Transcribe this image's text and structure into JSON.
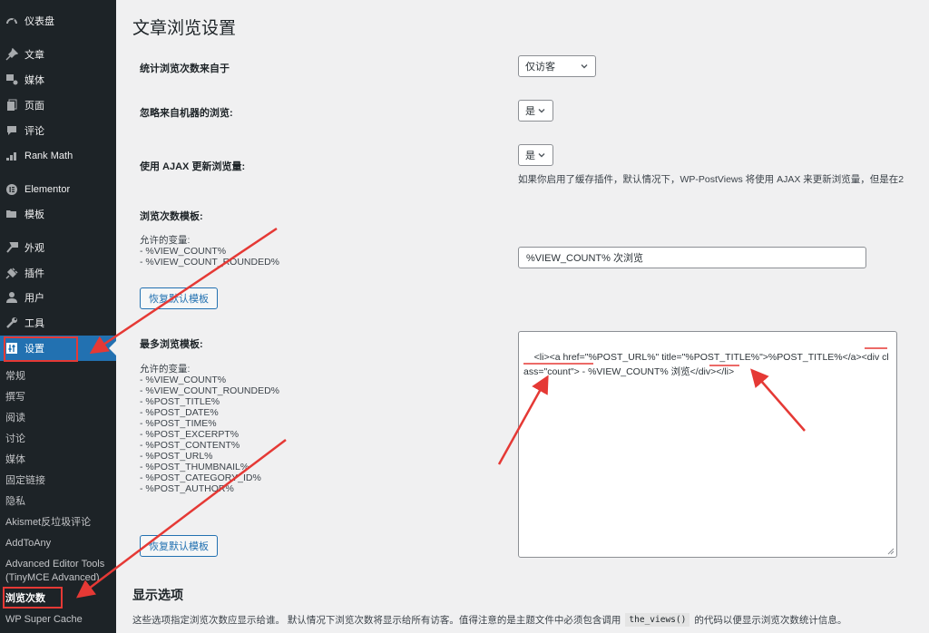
{
  "sidebar": {
    "items": [
      {
        "label": "仪表盘",
        "icon": "dashboard-icon"
      },
      {
        "label": "文章",
        "icon": "pin-icon"
      },
      {
        "label": "媒体",
        "icon": "media-icon"
      },
      {
        "label": "页面",
        "icon": "pages-icon"
      },
      {
        "label": "评论",
        "icon": "comment-icon"
      },
      {
        "label": "Rank Math",
        "icon": "rank-math-icon"
      },
      {
        "label": "Elementor",
        "icon": "elementor-icon"
      },
      {
        "label": "模板",
        "icon": "folder-icon"
      },
      {
        "label": "外观",
        "icon": "brush-icon"
      },
      {
        "label": "插件",
        "icon": "plug-icon"
      },
      {
        "label": "用户",
        "icon": "user-icon"
      },
      {
        "label": "工具",
        "icon": "wrench-icon"
      },
      {
        "label": "设置",
        "icon": "settings-icon",
        "active": true
      }
    ],
    "submenu": [
      "常规",
      "撰写",
      "阅读",
      "讨论",
      "媒体",
      "固定链接",
      "隐私",
      "Akismet反垃圾评论",
      "AddToAny",
      "Advanced Editor Tools",
      "(TinyMCE Advanced)",
      "浏览次数",
      "WP Super Cache"
    ],
    "current_submenu": "浏览次数"
  },
  "page": {
    "title": "文章浏览设置",
    "rows": {
      "count_from": {
        "label": "统计浏览次数来自于",
        "value": "仅访客"
      },
      "exclude_bots": {
        "label": "忽略来自机器的浏览:",
        "value": "是"
      },
      "use_ajax": {
        "label": "使用 AJAX 更新浏览量:",
        "value": "是",
        "help": "如果你启用了缓存插件，默认情况下，WP-PostViews 将使用 AJAX 来更新浏览量，但是在2"
      },
      "views_template": {
        "label": "浏览次数模板:",
        "vars_title": "允许的变量:",
        "vars": [
          "- %VIEW_COUNT%",
          "- %VIEW_COUNT_ROUNDED%"
        ],
        "value": "%VIEW_COUNT% 次浏览",
        "restore_button": "恢复默认模板"
      },
      "most_viewed_template": {
        "label": "最多浏览模板:",
        "vars_title": "允许的变量:",
        "vars": [
          "- %VIEW_COUNT%",
          "- %VIEW_COUNT_ROUNDED%",
          "- %POST_TITLE%",
          "- %POST_DATE%",
          "- %POST_TIME%",
          "- %POST_EXCERPT%",
          "- %POST_CONTENT%",
          "- %POST_URL%",
          "- %POST_THUMBNAIL%",
          "- %POST_CATEGORY_ID%",
          "- %POST_AUTHOR%"
        ],
        "value": "<li><a href=\"%POST_URL%\" title=\"%POST_TITLE%\">%POST_TITLE%</a><div class=\"count\"> - %VIEW_COUNT% 浏览</div></li>",
        "restore_button": "恢复默认模板"
      }
    },
    "display_section": {
      "title": "显示选项",
      "desc_before": "这些选项指定浏览次数应显示给谁。 默认情况下浏览次数将显示给所有访客。值得注意的是主题文件中必须包含调用",
      "code": "the_views()",
      "desc_after": "的代码以便显示浏览次数统计信息。"
    }
  },
  "annotation_color": "#e53935"
}
